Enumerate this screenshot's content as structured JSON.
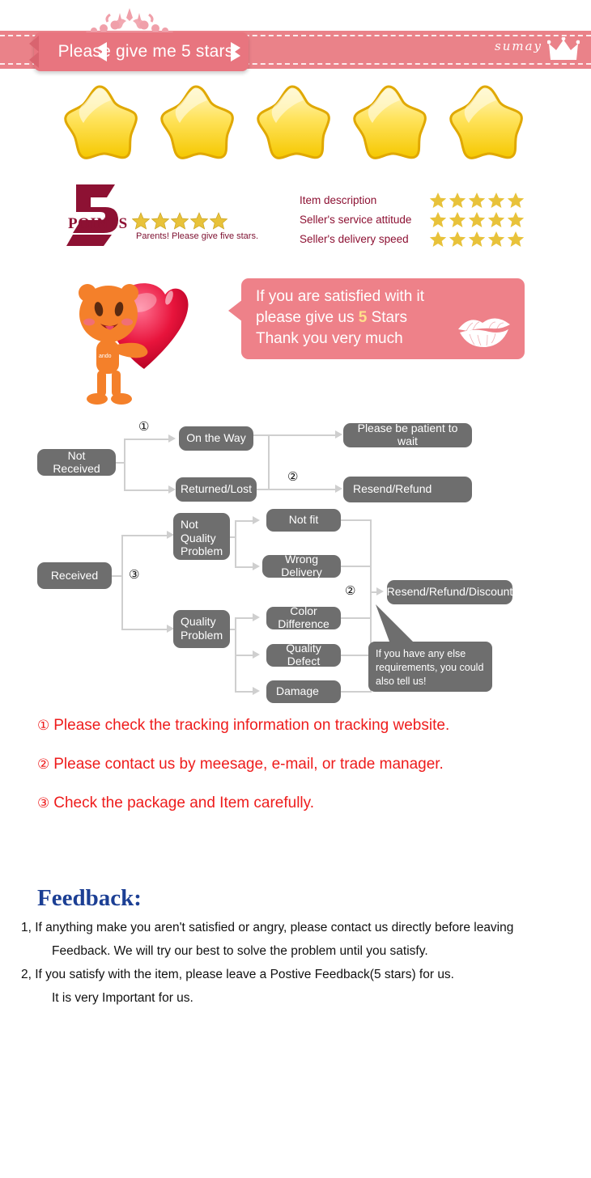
{
  "header": {
    "title": "Please give me 5 stars",
    "brand": "sumay",
    "tiara_icon": "tiara-icon",
    "crown_icon": "crown-icon",
    "band_color": "#ea8289",
    "plate_color": "#e8757f"
  },
  "big_stars": {
    "count": 5,
    "icon": "star-icon",
    "color": "#f7d327"
  },
  "points": {
    "number": "5",
    "word": "POINTS",
    "subtitle": "Parents! Please give five stars.",
    "stars": 5,
    "color": "#8d1133"
  },
  "ratings": {
    "rows": [
      {
        "label": "Item description",
        "stars": 5
      },
      {
        "label": "Seller's service attitude",
        "stars": 5
      },
      {
        "label": "Seller's delivery speed",
        "stars": 5
      }
    ],
    "label_color": "#8d1133",
    "star_color": "#e8c23a"
  },
  "bubble": {
    "line1": "If you are satisfied with it",
    "line2_pre": "please give us",
    "line2_num": "5",
    "line2_post": "Stars",
    "line3": "Thank you very much",
    "lips_icon": "lips-kiss-icon",
    "mascot_icon": "mascot-holding-heart-icon",
    "color": "#ee8189",
    "highlight_color": "#ffe08a"
  },
  "flowchart": {
    "box_color": "#6e6e6e",
    "line_color": "#cfcfcf",
    "nodes": {
      "not_received": "Not Received",
      "on_the_way": "On the Way",
      "returned_lost": "Returned/Lost",
      "please_wait": "Please be patient to wait",
      "resend_refund": "Resend/Refund",
      "received": "Received",
      "not_quality_problem": "Not\nQuality\nProblem",
      "quality_problem": "Quality\nProblem",
      "not_fit": "Not fit",
      "wrong_delivery": "Wrong Delivery",
      "color_difference": "Color Difference",
      "quality_defect": "Quality Defect",
      "damage": "Damage",
      "resend_refund_discount": "Resend/Refund/Discount"
    },
    "markers": {
      "one": "①",
      "two": "②",
      "three": "③"
    },
    "tip_note": "If you have any else requirements, you could also tell us!"
  },
  "red_notes": [
    {
      "num": "①",
      "text": "Please check the tracking information on tracking website."
    },
    {
      "num": "②",
      "text": "Please contact us by meesage, e-mail, or trade manager."
    },
    {
      "num": "③",
      "text": "Check the package and Item carefully."
    }
  ],
  "feedback": {
    "title": "Feedback:",
    "color": "#1c3f94",
    "lines": [
      "1, If anything make you aren't satisfied or angry, please contact us directly before leaving",
      "Feedback. We will try our best to solve the problem until you satisfy.",
      "2, If you satisfy with the item, please leave a Postive Feedback(5 stars) for us.",
      "It is very Important for us."
    ]
  }
}
